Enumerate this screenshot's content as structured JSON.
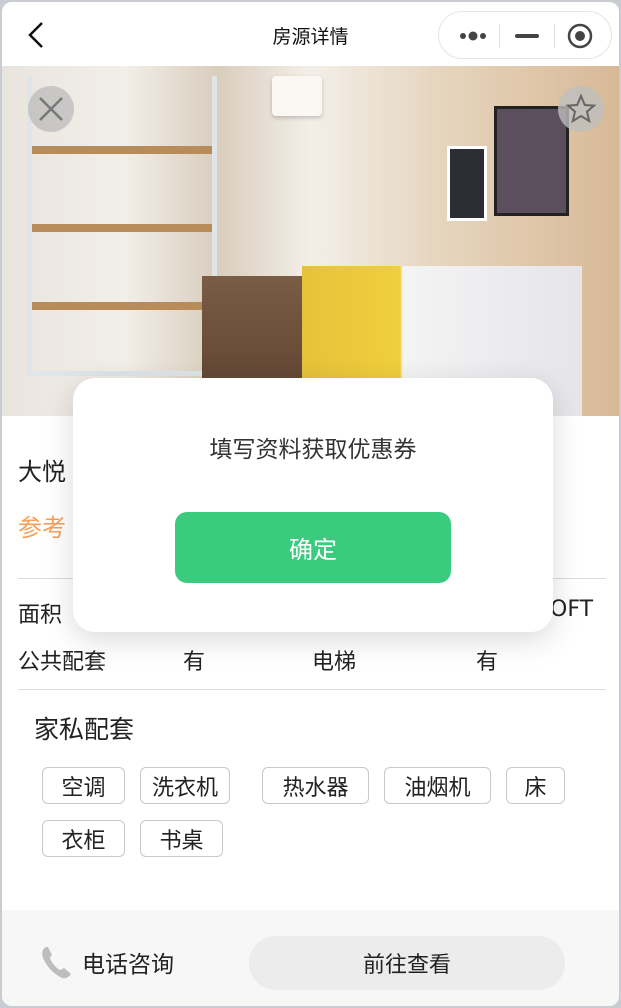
{
  "nav": {
    "title": "房源详情",
    "back_icon": "chevron-left-icon",
    "menu_icon": "more-dots-icon",
    "minimize_icon": "minus-icon",
    "close_icon": "target-circle-icon"
  },
  "photo": {
    "close_icon": "close-icon",
    "favorite_icon": "star-icon"
  },
  "listing": {
    "name_visible": "大悦",
    "price_label_visible": "参考",
    "price_color": "#f5a05a",
    "area_label": "面积",
    "type_value_visible": "OFT",
    "public_facilities_label": "公共配套",
    "public_facilities_value": "有",
    "elevator_label": "电梯",
    "elevator_value": "有"
  },
  "furniture": {
    "title": "家私配套",
    "items": [
      "空调",
      "洗衣机",
      "热水器",
      "油烟机",
      "床",
      "衣柜",
      "书桌"
    ]
  },
  "bottom": {
    "phone_icon": "phone-icon",
    "phone_label": "电话咨询",
    "goto_label": "前往查看"
  },
  "modal": {
    "title": "填写资料获取优惠券",
    "confirm_label": "确定",
    "accent": "#3acb7e"
  }
}
